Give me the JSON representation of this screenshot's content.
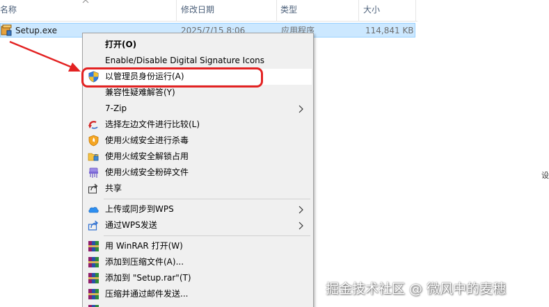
{
  "columns": {
    "name": "名称",
    "date": "修改日期",
    "type": "类型",
    "size": "大小"
  },
  "file": {
    "name": "Setup.exe",
    "date": "2025/7/15 8:06",
    "type": "应用程序",
    "size": "114,841 KB",
    "icon": "installer-exe-icon"
  },
  "menu": {
    "items": [
      {
        "label": "打开(O)",
        "icon": ""
      },
      {
        "label": "Enable/Disable Digital Signature Icons",
        "icon": ""
      },
      {
        "label": "以管理员身份运行(A)",
        "icon": "uac-shield-icon"
      },
      {
        "label": "兼容性疑难解答(Y)",
        "icon": ""
      },
      {
        "label": "7-Zip",
        "icon": "",
        "submenu": true
      },
      {
        "label": "选择左边文件进行比较(L)",
        "icon": "compare-icon"
      },
      {
        "label": "使用火绒安全进行杀毒",
        "icon": "huorong-shield-icon"
      },
      {
        "label": "使用火绒安全解锁占用",
        "icon": "unlock-folder-icon"
      },
      {
        "label": "使用火绒安全粉碎文件",
        "icon": "shredder-icon"
      },
      {
        "label": "共享",
        "icon": "share-icon"
      },
      {
        "label": "上传或同步到WPS",
        "icon": "wps-cloud-icon",
        "submenu": true
      },
      {
        "label": "通过WPS发送",
        "icon": "wps-send-icon",
        "submenu": true
      },
      {
        "label": "用 WinRAR 打开(W)",
        "icon": "winrar-icon"
      },
      {
        "label": "添加到压缩文件(A)...",
        "icon": "winrar-icon"
      },
      {
        "label": "添加到 \"Setup.rar\"(T)",
        "icon": "winrar-icon"
      },
      {
        "label": "压缩并通过邮件发送...",
        "icon": "winrar-icon"
      }
    ]
  },
  "side_glyph": "设",
  "watermark": "掘金技术社区 @ 微风中的麦穗",
  "colors": {
    "selection": "#cce8ff",
    "annotation_red": "#e32222",
    "menu_bg": "#f0f0f0"
  }
}
